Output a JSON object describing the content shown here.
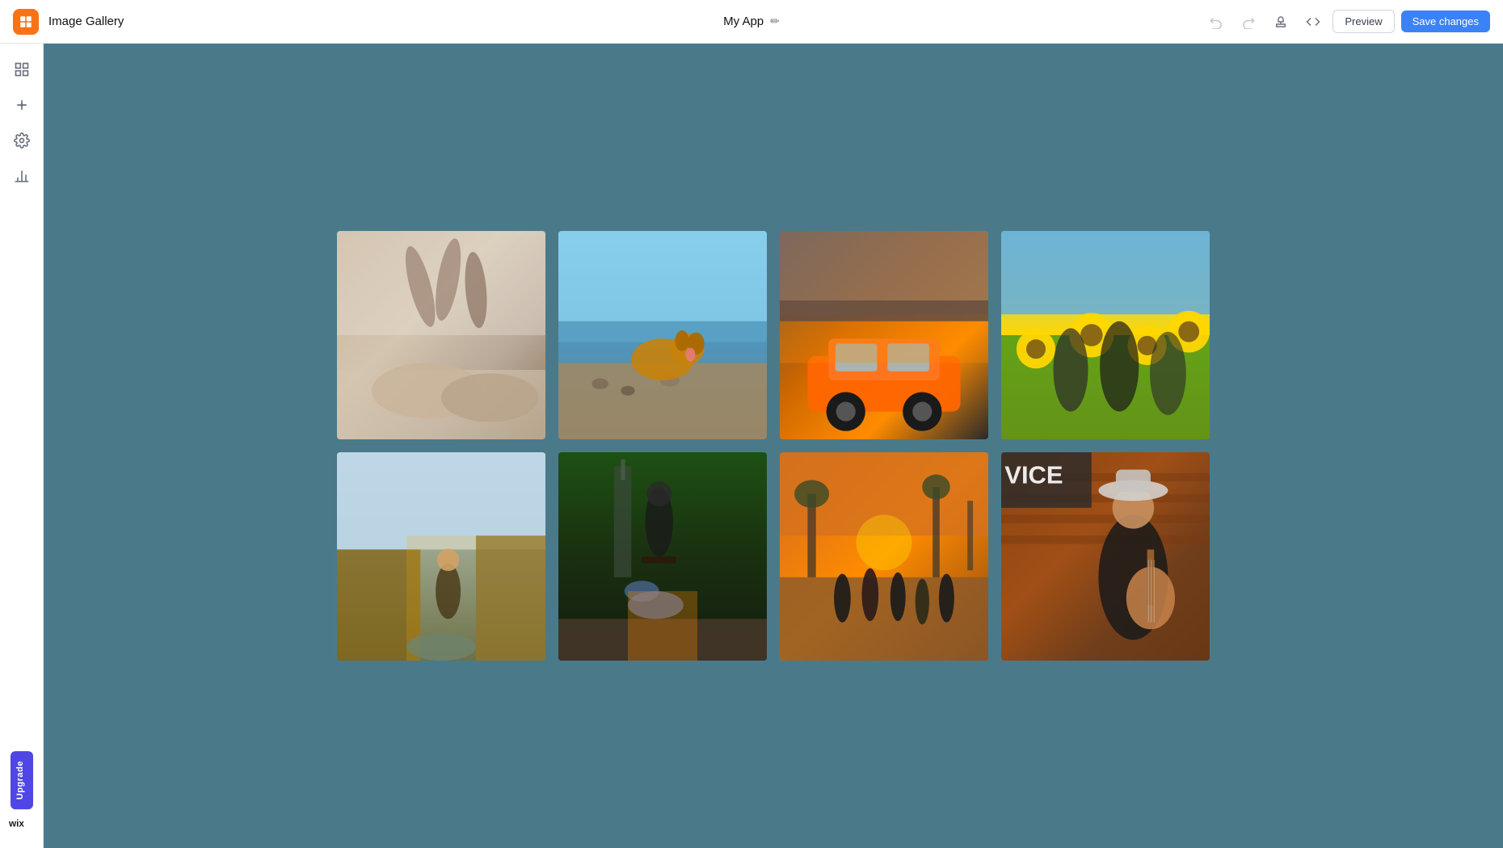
{
  "header": {
    "logo_label": "Image Gallery",
    "app_name": "Image Gallery",
    "title": "My App",
    "edit_icon": "✏",
    "undo_icon": "↩",
    "redo_icon": "↪",
    "stamp_icon": "🖊",
    "code_icon": "</>",
    "preview_label": "Preview",
    "save_label": "Save changes"
  },
  "sidebar": {
    "items": [
      {
        "id": "dashboard",
        "icon": "⊞",
        "label": "Dashboard",
        "active": false
      },
      {
        "id": "add",
        "icon": "✚",
        "label": "Add",
        "active": false
      },
      {
        "id": "settings",
        "icon": "⚙",
        "label": "Settings",
        "active": false
      },
      {
        "id": "analytics",
        "icon": "📊",
        "label": "Analytics",
        "active": false
      }
    ],
    "upgrade_label": "Upgrade",
    "wix_logo": "wix"
  },
  "gallery": {
    "images": [
      {
        "id": 1,
        "alt": "Two people lying on floor",
        "color_top": "#d4c5b0",
        "color_bottom": "#8b7355"
      },
      {
        "id": 2,
        "alt": "Dog on beach",
        "color_top": "#87ceeb",
        "color_bottom": "#8b7355"
      },
      {
        "id": 3,
        "alt": "Orange car under bridge",
        "color_top": "#8b7355",
        "color_bottom": "#4a4a4a"
      },
      {
        "id": 4,
        "alt": "Women in sunflower field",
        "color_top": "#87ceeb",
        "color_bottom": "#ffa500"
      },
      {
        "id": 5,
        "alt": "Woman at canyon",
        "color_top": "#87ceeb",
        "color_bottom": "#2f4f4f"
      },
      {
        "id": 6,
        "alt": "Skateboard trick",
        "color_top": "#228b22",
        "color_bottom": "#4169e1"
      },
      {
        "id": 7,
        "alt": "People running in desert",
        "color_top": "#d2691e",
        "color_bottom": "#8b4513"
      },
      {
        "id": 8,
        "alt": "Musician with guitar",
        "color_top": "#8b4513",
        "color_bottom": "#2f2f2f"
      }
    ]
  },
  "colors": {
    "accent": "#3b82f6",
    "canvas_bg": "#4a7a8a",
    "sidebar_bg": "#ffffff",
    "upgrade_btn": "#4f46e5"
  }
}
